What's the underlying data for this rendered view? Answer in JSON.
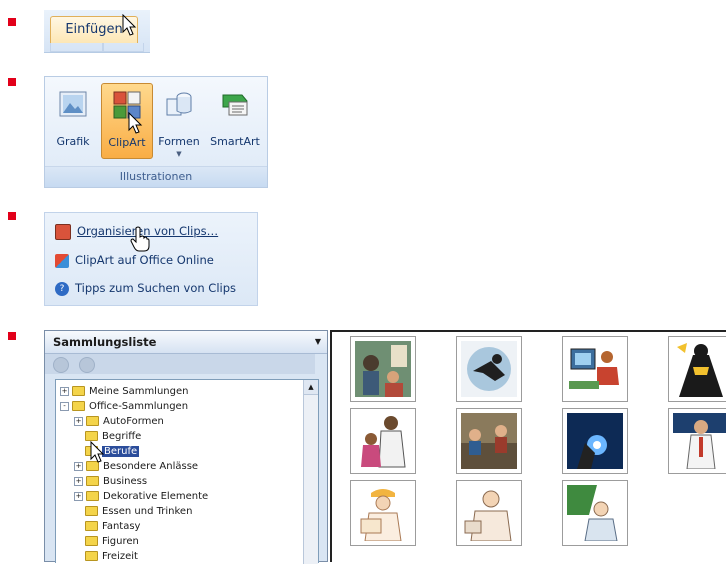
{
  "steps": {
    "marker_color": "#e2001a"
  },
  "ribbon_tab": {
    "label": "Einfügen"
  },
  "illustrations": {
    "group_label": "Illustrationen",
    "buttons": [
      {
        "label": "Grafik",
        "icon": "picture-icon"
      },
      {
        "label": "ClipArt",
        "icon": "clipart-icon",
        "active": true
      },
      {
        "label": "Formen",
        "icon": "shapes-icon"
      },
      {
        "label": "SmartArt",
        "icon": "smartart-icon"
      }
    ]
  },
  "clipart_links": [
    {
      "label": "Organisieren von Clips…",
      "icon": "organizer-icon"
    },
    {
      "label": "ClipArt auf Office Online",
      "icon": "office-online-icon"
    },
    {
      "label": "Tipps zum Suchen von Clips",
      "icon": "help-icon"
    }
  ],
  "organizer": {
    "title": "Sammlungsliste",
    "tree": [
      {
        "label": "Meine Sammlungen",
        "expander": "+"
      },
      {
        "label": "Office-Sammlungen",
        "expander": "-"
      },
      {
        "label": "AutoFormen",
        "expander": "+"
      },
      {
        "label": "Begriffe",
        "expander": ""
      },
      {
        "label": "Berufe",
        "expander": "",
        "selected": true
      },
      {
        "label": "Besondere Anlässe",
        "expander": "+"
      },
      {
        "label": "Business",
        "expander": "+"
      },
      {
        "label": "Dekorative Elemente",
        "expander": "+"
      },
      {
        "label": "Essen und Trinken",
        "expander": ""
      },
      {
        "label": "Fantasy",
        "expander": ""
      },
      {
        "label": "Figuren",
        "expander": ""
      },
      {
        "label": "Freizeit",
        "expander": ""
      }
    ]
  },
  "clips": [
    "optician-clip",
    "welder-clip",
    "office-worker-clip",
    "construction-clip",
    "doctor-child-clip",
    "meeting-clip",
    "spark-welder-clip",
    "scientist-clip",
    "engineer-clip",
    "businessman-clip",
    "teacher-clip"
  ]
}
